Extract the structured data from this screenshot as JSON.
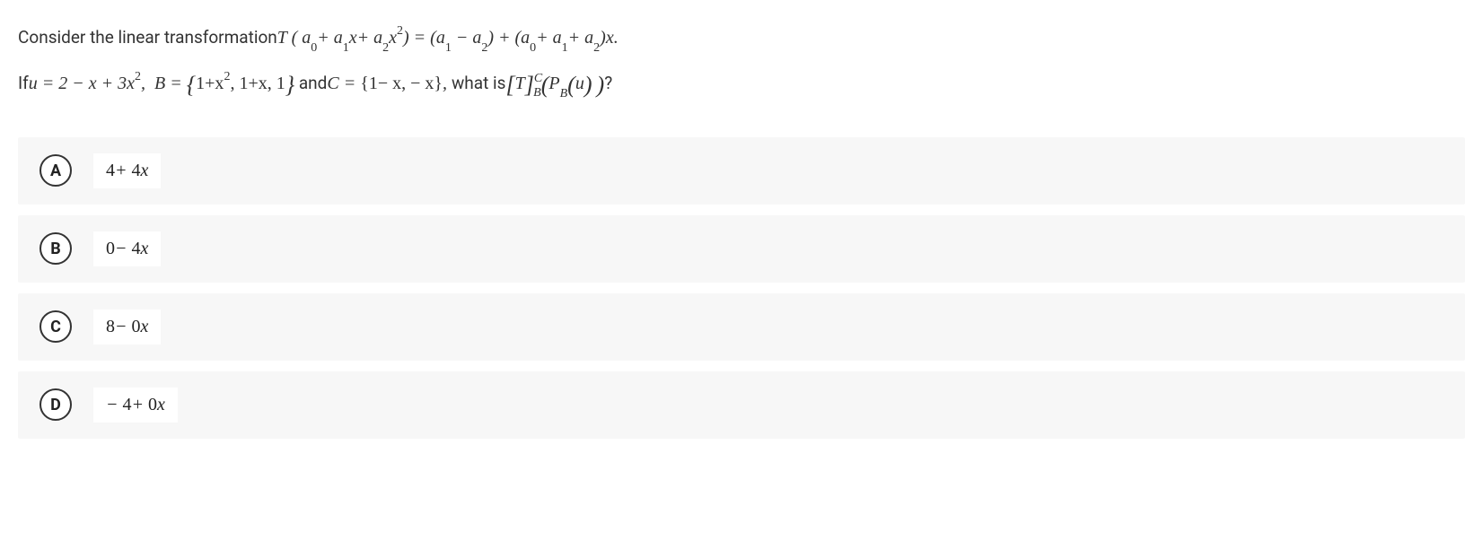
{
  "problem": {
    "line1_prefix": "Consider the linear transformation",
    "line2_prefix": "If",
    "line2_mid1": "and",
    "line2_mid2": "what is",
    "transformation": {
      "T": "T",
      "lhs_a0": "a",
      "lhs_a1": "a",
      "lhs_a2": "a",
      "x": "x",
      "rhs_a1": "a",
      "rhs_a2": "a",
      "rhs_b0": "a",
      "rhs_b1": "a",
      "rhs_b2": "a"
    },
    "u_def": "u = 2 − x + 3x",
    "u_exp": "2",
    "B_label": "B",
    "B_set": "1+x",
    "B_exp": "2",
    "B_rest": ",  1+x,  1",
    "C_label": "C",
    "C_set": "{1− x,  − x}",
    "result_T": "T",
    "result_B": "B",
    "result_C": "C",
    "result_P": "P",
    "result_Bsub": "B",
    "result_u": "u",
    "qmark": "?"
  },
  "options": [
    {
      "letter": "A",
      "text": "4 + 4x"
    },
    {
      "letter": "B",
      "text": "0 − 4x"
    },
    {
      "letter": "C",
      "text": "8 − 0x"
    },
    {
      "letter": "D",
      "text": "− 4 + 0x"
    }
  ],
  "chart_data": {
    "type": "table",
    "title": "Multiple choice problem: linear transformation and change-of-basis computation",
    "question_summary": "Given T(a0+a1 x+a2 x^2)=(a1−a2)+(a0+a1+a2)x, u=2−x+3x^2, B={1+x^2,1+x,1}, C={1−x,−x}, compute [T]_B^C (P_B(u)).",
    "options": [
      {
        "label": "A",
        "value": "4 + 4x"
      },
      {
        "label": "B",
        "value": "0 − 4x"
      },
      {
        "label": "C",
        "value": "8 − 0x"
      },
      {
        "label": "D",
        "value": "−4 + 0x"
      }
    ]
  }
}
